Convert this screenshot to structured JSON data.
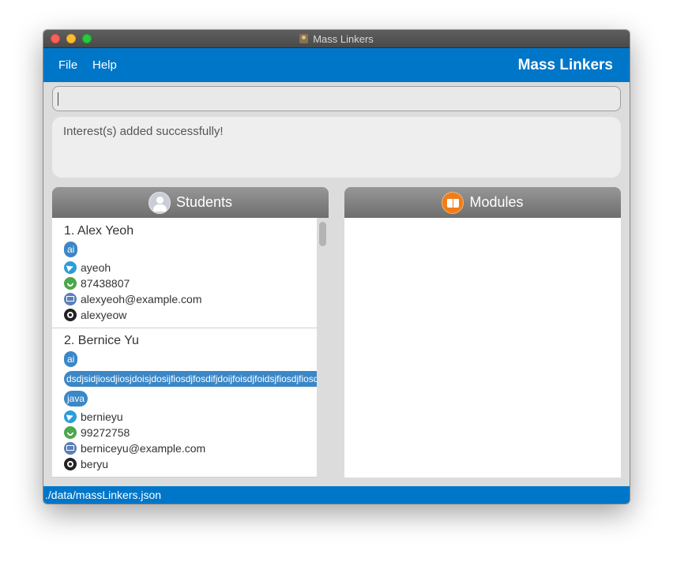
{
  "window": {
    "title": "Mass Linkers"
  },
  "menu": {
    "file": "File",
    "help": "Help"
  },
  "app_title": "Mass Linkers",
  "command": {
    "value": ""
  },
  "result": {
    "message": "Interest(s) added successfully!"
  },
  "students_panel": {
    "title": "Students",
    "icon": "student-icon"
  },
  "modules_panel": {
    "title": "Modules",
    "icon": "book-icon"
  },
  "students": [
    {
      "name": "1. Alex Yeoh",
      "tags": [
        "ai"
      ],
      "telegram": "ayeoh",
      "phone": "87438807",
      "email": "alexyeoh@example.com",
      "github": "alexyeow"
    },
    {
      "name": "2. Bernice Yu",
      "tags": [
        "ai",
        "dsdjsidjiosdjiosjdoisjdosijfiosdjfosdifjdoijfoisdjfoidsjfiosdjfiosdjfoidsjf",
        "java"
      ],
      "telegram": "bernieyu",
      "phone": "99272758",
      "email": "berniceyu@example.com",
      "github": "beryu"
    }
  ],
  "status": {
    "path": "./data/massLinkers.json"
  },
  "colors": {
    "primary": "#0076c9",
    "tag": "#3b87c7",
    "header": "#7f7f7f"
  }
}
